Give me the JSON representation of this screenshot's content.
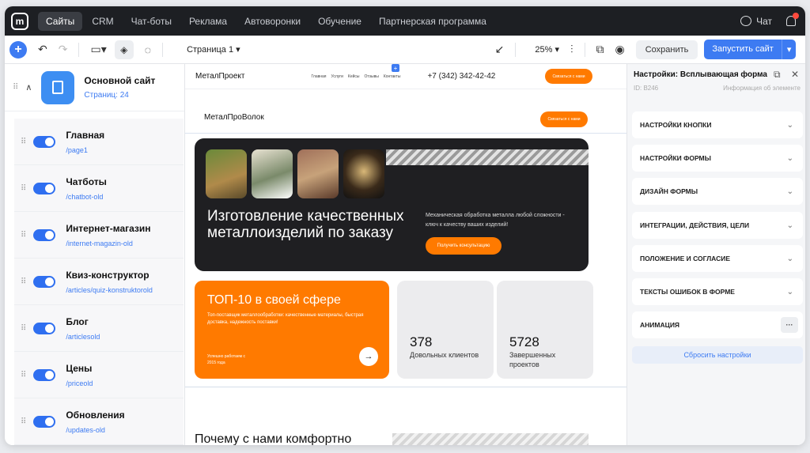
{
  "topnav": {
    "logo": "m",
    "items": [
      "Сайты",
      "CRM",
      "Чат-боты",
      "Реклама",
      "Автоворонки",
      "Обучение",
      "Партнерская программа"
    ],
    "chat_label": "Чат"
  },
  "toolbar": {
    "page_select": "Страница 1",
    "zoom": "25%",
    "save_label": "Сохранить",
    "launch_label": "Запустить сайт"
  },
  "sidebar": {
    "site_name": "Основной сайт",
    "pages_count": "Страниц: 24",
    "pages": [
      {
        "name": "Главная",
        "url": "/page1"
      },
      {
        "name": "Чатботы",
        "url": "/chatbot-old"
      },
      {
        "name": "Интернет-магазин",
        "url": "/internet-magazin-old"
      },
      {
        "name": "Квиз-конструктор",
        "url": "/articles/quiz-konstruktorold"
      },
      {
        "name": "Блог",
        "url": "/articlesold"
      },
      {
        "name": "Цены",
        "url": "/priceold"
      },
      {
        "name": "Обновления",
        "url": "/updates-old"
      }
    ]
  },
  "canvas": {
    "logo1": "МеталПроект",
    "nav": [
      "Главная",
      "Услуги",
      "Кейсы",
      "Отзывы",
      "Контакты"
    ],
    "phone": "+7 (342) 342-42-42",
    "cta_small": "Связаться с нами",
    "logo2": "МеталПроВолок",
    "hero_title": "Изготовление качественных металлоизделий по заказу",
    "hero_desc": "Механическая обработка металла любой сложности - ключ к качеству ваших изделий!",
    "hero_btn": "Получить консультацию",
    "top_title": "ТОП-10 в своей сфере",
    "top_desc": "Топ-поставщик металлообработки: качественные материалы, быстрая доставка, надежность поставки!",
    "top_foot": "Успешно работаем с 2015 года",
    "stats": [
      {
        "num": "378",
        "label": "Довольных клиентов"
      },
      {
        "num": "5728",
        "label": "Завершенных проектов"
      }
    ],
    "why_title": "Почему с нами комфортно работать?"
  },
  "rpanel": {
    "title": "Настройки: Всплывающая форма",
    "id": "ID: B246",
    "info": "Информация об элементе",
    "sections": [
      "НАСТРОЙКИ КНОПКИ",
      "НАСТРОЙКИ ФОРМЫ",
      "ДИЗАЙН ФОРМЫ",
      "ИНТЕГРАЦИИ, ДЕЙСТВИЯ, ЦЕЛИ",
      "ПОЛОЖЕНИЕ И СОГЛАСИЕ",
      "ТЕКСТЫ ОШИБОК В ФОРМЕ",
      "АНИМАЦИЯ"
    ],
    "reset": "Сбросить настройки"
  },
  "colors": {
    "accent": "#3d7bf2",
    "orange": "#ff7a00",
    "dark": "#1f1f22"
  },
  "icons": [
    "plus-icon",
    "undo-icon",
    "redo-icon",
    "desktop-icon",
    "layers-icon",
    "drop-icon",
    "collapse-icon",
    "sliders-icon",
    "external-link-icon",
    "eye-icon",
    "copy-icon",
    "close-icon",
    "bell-icon",
    "chat-icon"
  ]
}
